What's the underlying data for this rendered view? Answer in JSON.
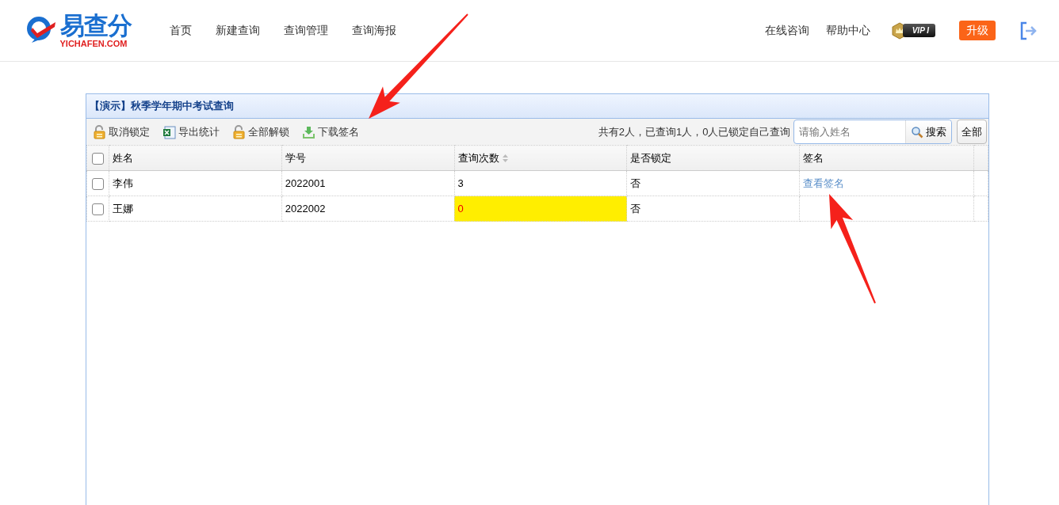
{
  "header": {
    "logo": {
      "name": "易查分",
      "domain": "YICHAFEN.COM"
    },
    "nav": [
      {
        "label": "首页"
      },
      {
        "label": "新建查询"
      },
      {
        "label": "查询管理"
      },
      {
        "label": "查询海报"
      }
    ],
    "right_links": [
      {
        "label": "在线咨询"
      },
      {
        "label": "帮助中心"
      }
    ],
    "vip_badge": {
      "label": "VIP",
      "level": "I"
    },
    "upgrade_button": "升级"
  },
  "panel": {
    "title": "【演示】秋季学年期中考试查询",
    "toolbar": [
      {
        "label": "取消锁定",
        "kind": "lock"
      },
      {
        "label": "导出统计",
        "kind": "excel"
      },
      {
        "label": "全部解锁",
        "kind": "lock"
      },
      {
        "label": "下载签名",
        "kind": "download"
      }
    ],
    "summary": "共有2人，已查询1人，0人已锁定自己查询",
    "search": {
      "placeholder": "请输入姓名",
      "button": "搜索"
    },
    "all_button": "全部",
    "table": {
      "select_all_checked": false,
      "columns": [
        {
          "label": "姓名",
          "sortable": false
        },
        {
          "label": "学号",
          "sortable": false
        },
        {
          "label": "查询次数",
          "sortable": true
        },
        {
          "label": "是否锁定",
          "sortable": false
        },
        {
          "label": "签名",
          "sortable": false
        }
      ],
      "rows": [
        {
          "checked": false,
          "name": "李伟",
          "id": "2022001",
          "count": "3",
          "count_highlighted": false,
          "locked": "否",
          "signature": "查看签名"
        },
        {
          "checked": false,
          "name": "王娜",
          "id": "2022002",
          "count": "0",
          "count_highlighted": true,
          "locked": "否"
        }
      ]
    }
  },
  "annotations": [
    {
      "kind": "arrow"
    },
    {
      "kind": "arrow"
    }
  ]
}
